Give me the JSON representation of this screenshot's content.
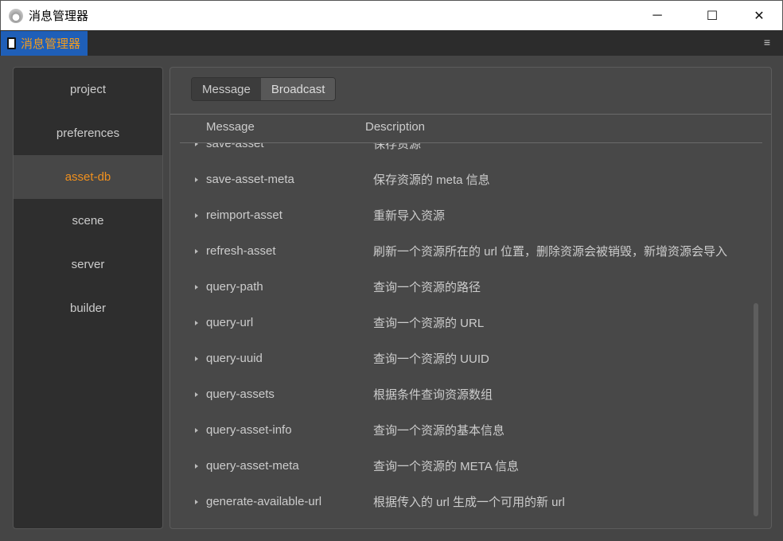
{
  "window": {
    "title": "消息管理器",
    "minimize": "─",
    "maximize": "☐",
    "close": "✕"
  },
  "tab": {
    "label": "消息管理器",
    "menu": "≡"
  },
  "sidebar": {
    "items": [
      {
        "label": "project"
      },
      {
        "label": "preferences"
      },
      {
        "label": "asset-db",
        "active": true
      },
      {
        "label": "scene"
      },
      {
        "label": "server"
      },
      {
        "label": "builder"
      }
    ]
  },
  "segment": {
    "message": "Message",
    "broadcast": "Broadcast"
  },
  "columns": {
    "message": "Message",
    "description": "Description"
  },
  "rows": [
    {
      "message": "save-asset",
      "description": "保存资源"
    },
    {
      "message": "save-asset-meta",
      "description": "保存资源的 meta 信息"
    },
    {
      "message": "reimport-asset",
      "description": "重新导入资源"
    },
    {
      "message": "refresh-asset",
      "description": "刷新一个资源所在的 url 位置，删除资源会被销毁，新增资源会导入"
    },
    {
      "message": "query-path",
      "description": "查询一个资源的路径"
    },
    {
      "message": "query-url",
      "description": "查询一个资源的 URL"
    },
    {
      "message": "query-uuid",
      "description": "查询一个资源的 UUID"
    },
    {
      "message": "query-assets",
      "description": "根据条件查询资源数组"
    },
    {
      "message": "query-asset-info",
      "description": "查询一个资源的基本信息"
    },
    {
      "message": "query-asset-meta",
      "description": "查询一个资源的 META 信息"
    },
    {
      "message": "generate-available-url",
      "description": "根据传入的 url 生成一个可用的新 url"
    }
  ]
}
